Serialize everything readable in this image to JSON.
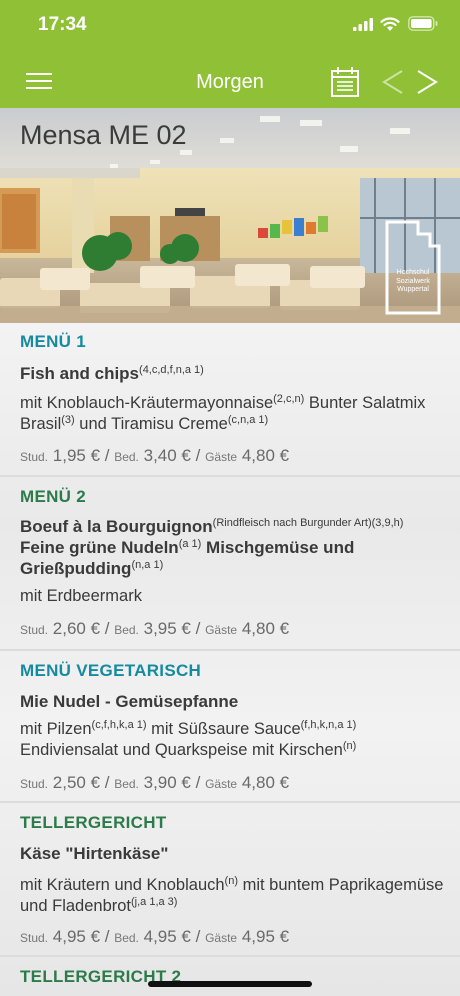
{
  "status": {
    "time": "17:34"
  },
  "nav": {
    "title": "Morgen"
  },
  "hero": {
    "title": "Mensa ME 02",
    "logo_lines": [
      "Hochschul",
      "Sozialwerk",
      "Wuppertal"
    ]
  },
  "price_labels": {
    "stud": "Stud.",
    "bed": "Bed.",
    "gast": "Gäste"
  },
  "items": [
    {
      "category": "MENÜ 1",
      "dish": "Fish and chips",
      "dish_sup": "(4,c,d,f,n,a 1)",
      "d1": "mit Knoblauch-Kräutermayonnaise",
      "d1_sup": "(2,c,n)",
      "d2": " Bunter Salatmix Brasil",
      "d2_sup": "(3)",
      "d3": " und Tiramisu Creme",
      "d3_sup": "(c,n,a 1)",
      "stud": "1,95 €",
      "bed": "3,40 €",
      "gast": "4,80 €"
    },
    {
      "category": "MENÜ 2",
      "dish": "Boeuf à la Bourguignon",
      "dish_sup": "(Rindfleisch nach Burgunder Art)(3,9,h)",
      "dish2": " Feine grüne Nudeln",
      "dish2_sup": "(a 1)",
      "dish3": " Mischgemüse und Grießpudding",
      "dish3_sup": "(n,a 1)",
      "d1": "mit Erdbeermark",
      "stud": "2,60 €",
      "bed": "3,95 €",
      "gast": "4,80 €"
    },
    {
      "category": "MENÜ VEGETARISCH",
      "dish": "Mie Nudel - Gemüsepfanne",
      "d1": "mit Pilzen",
      "d1_sup": "(c,f,h,k,a 1)",
      "d2": " mit Süßsaure Sauce",
      "d2_sup": "(f,h,k,n,a 1)",
      "d3": " Endiviensalat und Quarkspeise mit Kirschen",
      "d3_sup": "(n)",
      "stud": "2,50 €",
      "bed": "3,90 €",
      "gast": "4,80 €"
    },
    {
      "category": "TELLERGERICHT",
      "dish": "Käse \"Hirtenkäse\"",
      "d1": "mit Kräutern und Knoblauch",
      "d1_sup": "(n)",
      "d2": " mit buntem Paprikagemüse und Fladenbrot",
      "d2_sup": "(j,a 1,a 3)",
      "stud": "4,95 €",
      "bed": "4,95 €",
      "gast": "4,95 €"
    },
    {
      "category": "TELLERGERICHT 2"
    }
  ]
}
